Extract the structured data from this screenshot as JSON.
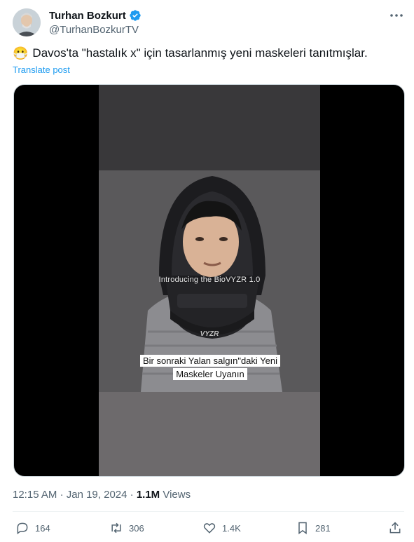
{
  "author": {
    "name": "Turhan Bozkurt",
    "handle": "@TurhanBozkurTV"
  },
  "post": {
    "emoji": "😷",
    "text": "Davos'ta \"hastalık x\" için tasarlanmış yeni maskeleri tanıtmışlar.",
    "translate_label": "Translate post"
  },
  "video": {
    "intro_text": "Introducing the BioVYZR 1.0",
    "helmet_logo": "VYZR",
    "caption_line1": "Bir sonraki  Yalan salgın\"daki Yeni",
    "caption_line2": "Maskeler Uyanın"
  },
  "meta": {
    "time": "12:15 AM",
    "separator": "·",
    "date": "Jan 19, 2024",
    "views_count": "1.1M",
    "views_label": "Views"
  },
  "actions": {
    "replies": "164",
    "reposts": "306",
    "likes": "1.4K",
    "bookmarks": "281"
  },
  "colors": {
    "accent": "#1d9bf0",
    "secondary_text": "#536471"
  }
}
